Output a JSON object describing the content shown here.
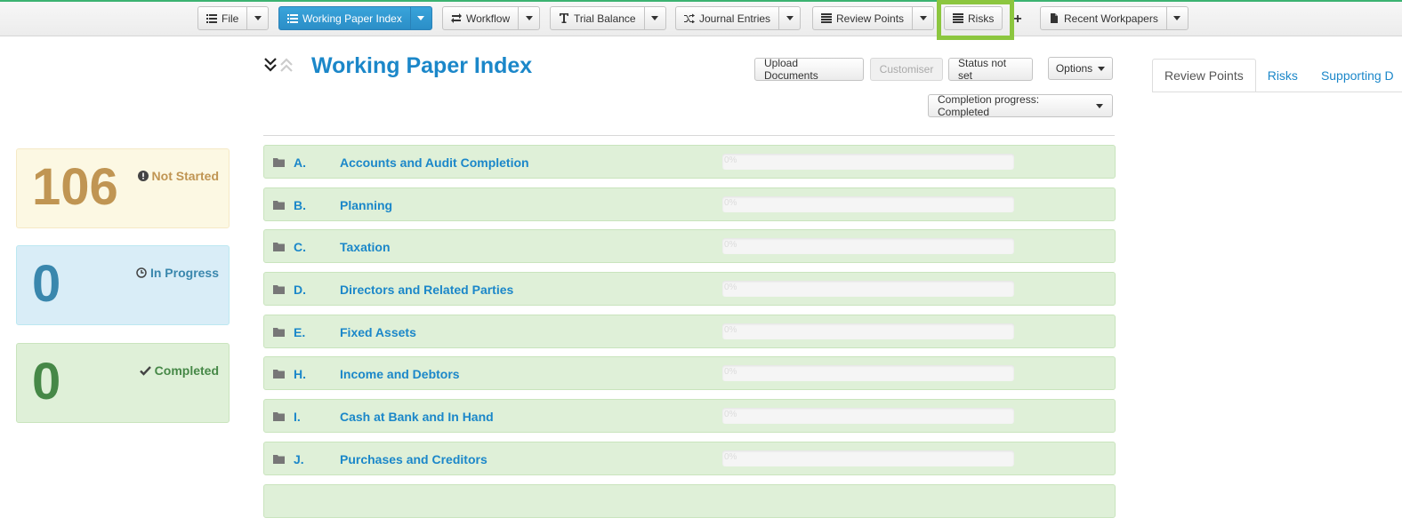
{
  "toolbar": {
    "file": "File",
    "working_paper_index": "Working Paper Index",
    "workflow": "Workflow",
    "trial_balance": "Trial Balance",
    "journal_entries": "Journal Entries",
    "review_points": "Review Points",
    "risks": "Risks",
    "add": "+",
    "recent_workpapers": "Recent Workpapers"
  },
  "page": {
    "title": "Working Paper Index",
    "upload_documents": "Upload Documents",
    "customiser": "Customiser",
    "status_not_set": "Status not set",
    "options": "Options",
    "completion_progress": "Completion progress: Completed"
  },
  "tabs": [
    "Review Points",
    "Risks",
    "Supporting D"
  ],
  "stats": {
    "not_started": {
      "count": "106",
      "label": "Not Started"
    },
    "in_progress": {
      "count": "0",
      "label": "In Progress"
    },
    "completed": {
      "count": "0",
      "label": "Completed"
    }
  },
  "sections": [
    {
      "code": "A.",
      "name": "Accounts and Audit Completion",
      "progress_label": "0%",
      "progress": 0
    },
    {
      "code": "B.",
      "name": "Planning",
      "progress_label": "0%",
      "progress": 0
    },
    {
      "code": "C.",
      "name": "Taxation",
      "progress_label": "0%",
      "progress": 0
    },
    {
      "code": "D.",
      "name": "Directors and Related Parties",
      "progress_label": "0%",
      "progress": 0
    },
    {
      "code": "E.",
      "name": "Fixed Assets",
      "progress_label": "0%",
      "progress": 0
    },
    {
      "code": "H.",
      "name": "Income and Debtors",
      "progress_label": "0%",
      "progress": 0
    },
    {
      "code": "I.",
      "name": "Cash at Bank and In Hand",
      "progress_label": "0%",
      "progress": 0
    },
    {
      "code": "J.",
      "name": "Purchases and Creditors",
      "progress_label": "0%",
      "progress": 0
    }
  ],
  "colors": {
    "accent": "#1b87c9",
    "primary_button": "#2b8ec7",
    "highlight": "#8cc63f",
    "not_started": "#c09553",
    "in_progress": "#3a87ad",
    "completed": "#468847"
  }
}
